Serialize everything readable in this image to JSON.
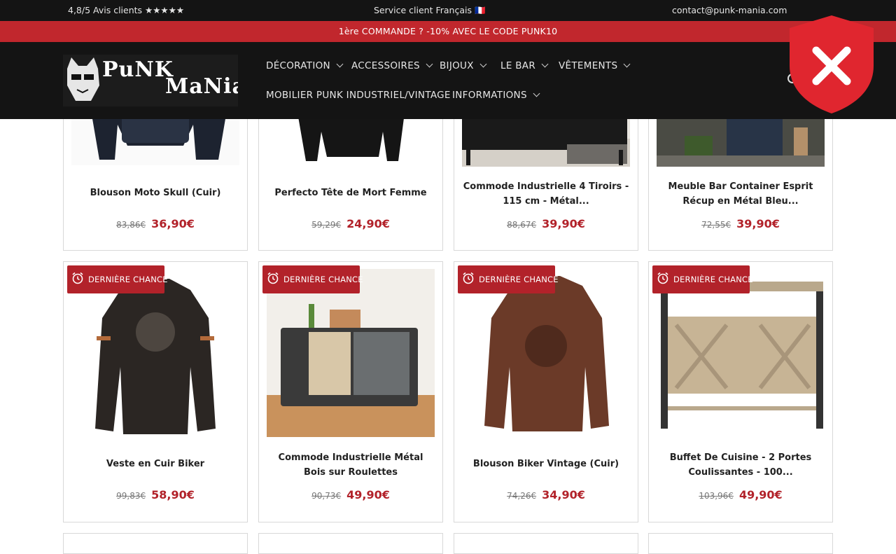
{
  "topbar": {
    "reviews": "4,8/5 Avis clients ★★★★★",
    "service": "Service client Français 🇫🇷",
    "email": "contact@punk-mania.com"
  },
  "promo": {
    "text": "1ère COMMANDE ? -10% AVEC LE CODE PUNK10"
  },
  "logo": {
    "part1": "PuNK",
    "part2": "MaNia"
  },
  "nav": {
    "items": [
      {
        "label": "DÉCORATION"
      },
      {
        "label": "ACCESSOIRES"
      },
      {
        "label": "BIJOUX"
      },
      {
        "label": "LE BAR"
      },
      {
        "label": "VÊTEMENTS"
      },
      {
        "label": "MOBILIER PUNK INDUSTRIEL/VINTAGE"
      },
      {
        "label": "INFORMATIONS"
      }
    ]
  },
  "badge": {
    "label": "DERNIÈRE CHANCE"
  },
  "products": [
    {
      "title": "Blouson Moto Skull (Cuir)",
      "old_price": "83,86€",
      "price": "36,90€"
    },
    {
      "title": "Perfecto Tête de Mort Femme",
      "old_price": "59,29€",
      "price": "24,90€"
    },
    {
      "title": "Commode Industrielle 4 Tiroirs - 115 cm - Métal...",
      "old_price": "88,67€",
      "price": "39,90€"
    },
    {
      "title": "Meuble Bar Container Esprit Récup en Métal Bleu...",
      "old_price": "72,55€",
      "price": "39,90€"
    },
    {
      "title": "Veste en Cuir Biker",
      "old_price": "99,83€",
      "price": "58,90€"
    },
    {
      "title": "Commode Industrielle Métal Bois sur Roulettes",
      "old_price": "90,73€",
      "price": "49,90€"
    },
    {
      "title": "Blouson Biker Vintage (Cuir)",
      "old_price": "74,26€",
      "price": "34,90€"
    },
    {
      "title": "Buffet De Cuisine - 2 Portes Coulissantes - 100...",
      "old_price": "103,96€",
      "price": "49,90€"
    }
  ],
  "colors": {
    "brand_red": "#b2222a",
    "header_bg": "#141414",
    "promo_bg": "#c1272d",
    "shield_red": "#e0262f"
  },
  "icons": {
    "blocked": "shield-x-icon",
    "badge": "alarm-clock-icon",
    "menu": "chevron-down-icon"
  }
}
